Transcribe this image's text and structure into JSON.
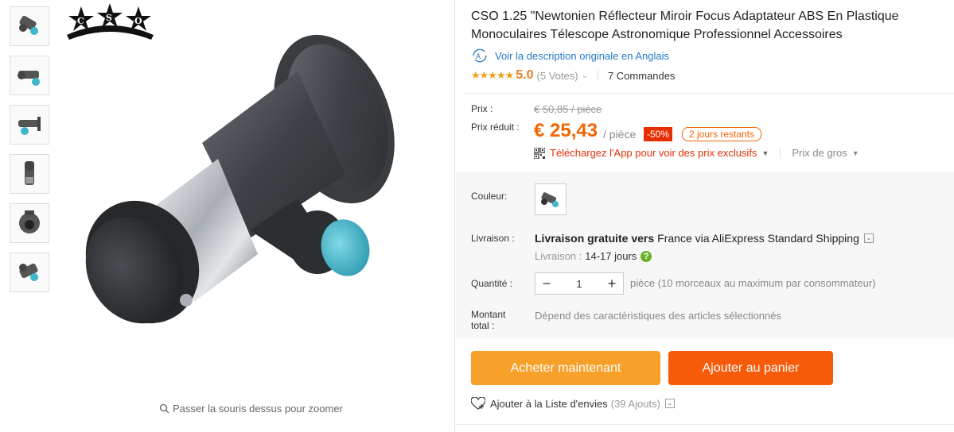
{
  "product": {
    "title": "CSO 1.25 \"Newtonien Réflecteur Miroir Focus Adaptateur ABS En Plastique Monoculaires Télescope Astronomique Professionnel Accessoires",
    "translate_link": "Voir la description originale en Anglais",
    "rating": {
      "stars": "★★★★★",
      "score": "5.0",
      "votes": "(5 Votes)",
      "orders": "7 Commandes"
    },
    "logo_text": "CSO",
    "zoom_hint": "Passer la souris dessus pour zoomer"
  },
  "price": {
    "label": "Prix :",
    "old": "€ 50,85 / pièce",
    "reduced_label": "Prix réduit :",
    "current": "€ 25,43",
    "unit": "/ pièce",
    "discount": "-50%",
    "days_left": "2 jours restants",
    "app_promo": "Téléchargez l'App pour voir des prix exclusifs",
    "bulk": "Prix de gros"
  },
  "options": {
    "color_label": "Couleur:",
    "shipping_label": "Livraison :",
    "shipping_bold": "Livraison gratuite vers",
    "shipping_rest": "France via AliExpress Standard Shipping",
    "delivery_label": "Livraison :",
    "delivery_time": "14-17 jours",
    "quantity_label": "Quantité :",
    "quantity_value": "1",
    "quantity_hint": "pièce (10 morceaux au maximum par consommateur)",
    "total_label_1": "Montant",
    "total_label_2": "total :",
    "total_note": "Dépend des caractéristiques des articles sélectionnés"
  },
  "actions": {
    "buy_now": "Acheter maintenant",
    "add_to_cart": "Ajouter au panier",
    "wishlist": "Ajouter à la Liste d'envies",
    "wishlist_count": "(39 Ajouts)"
  },
  "colors": {
    "accent": "#f56400",
    "buy": "#f8a12a",
    "cart": "#f75b0a",
    "link": "#2478c8",
    "star": "#f2a01b"
  }
}
